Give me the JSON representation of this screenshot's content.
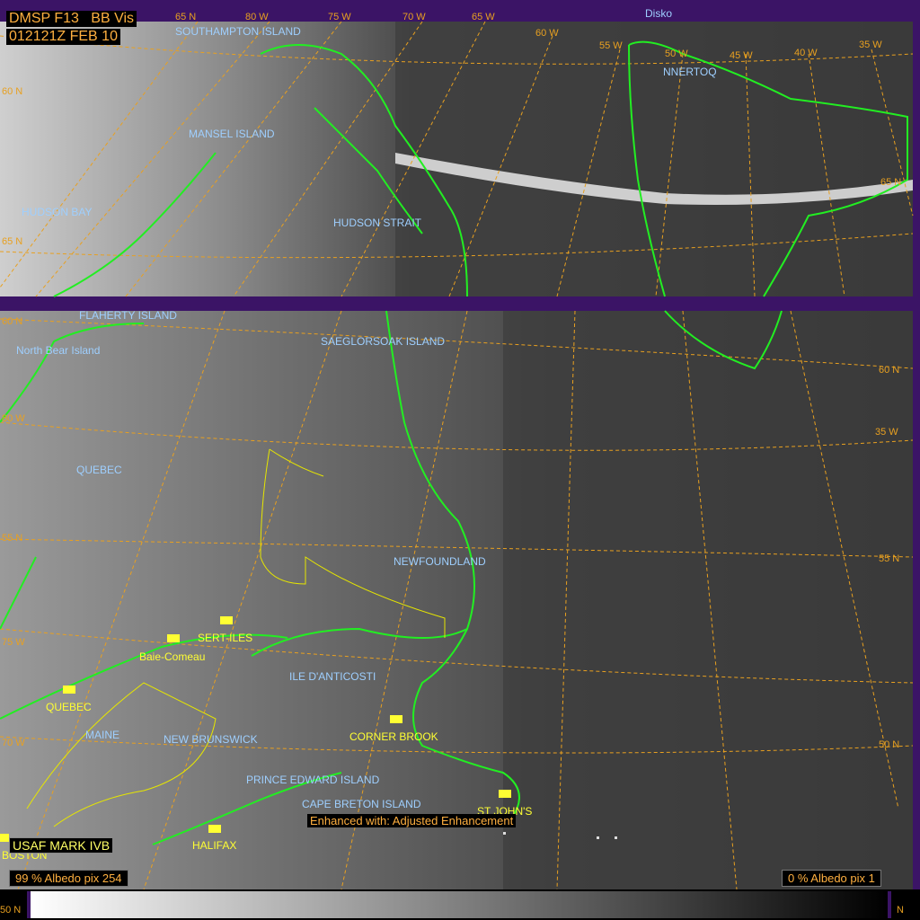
{
  "header": {
    "satellite": "DMSP F13",
    "channel": "BB Vis",
    "timestamp": "012121Z FEB 10"
  },
  "colors": {
    "frame": "#3b1466",
    "coastline": "#22ee22",
    "border": "#e6e600",
    "gridline": "#e8a020",
    "geo_label": "#9ecfff",
    "city_label": "#ffff33",
    "header_text": "#ffb040"
  },
  "footer": {
    "left_albedo": "99 % Albedo   pix 254",
    "right_albedo": "0  % Albedo   pix 1",
    "source": "USAF MARK IVB",
    "enhancement": "Enhanced with: Adjusted Enhancement"
  },
  "grid_labels": [
    "65 N",
    "80 W",
    "75 W",
    "70 W",
    "65 W",
    "60 W",
    "55 W",
    "50 W",
    "45 W",
    "40 W",
    "35 W",
    "60 N",
    "65 N",
    "55 N",
    "50 N",
    "35 W",
    "60 N",
    "80 W",
    "55 N",
    "50 N",
    "75 W",
    "70 W",
    "80 W",
    "N",
    "65 N",
    "60 N"
  ],
  "geo_labels": [
    "SOUTHAMPTON ISLAND",
    "MANSEL ISLAND",
    "HUDSON BAY",
    "HUDSON STRAIT",
    "FLAHERTY ISLAND",
    "North Bear Island",
    "SAEGLORSOAK ISLAND",
    "QUEBEC",
    "NEWFOUNDLAND",
    "ILE D'ANTICOSTI",
    "MAINE",
    "NEW BRUNSWICK",
    "PRINCE EDWARD ISLAND",
    "CAPE BRETON ISLAND",
    "Disko",
    "NNERTOQ"
  ],
  "city_labels": [
    "SERT-ILES",
    "Baie-Comeau",
    "QUEBEC",
    "CORNER BROOK",
    "ST JOHN'S",
    "HALIFAX",
    "BOSTON"
  ]
}
